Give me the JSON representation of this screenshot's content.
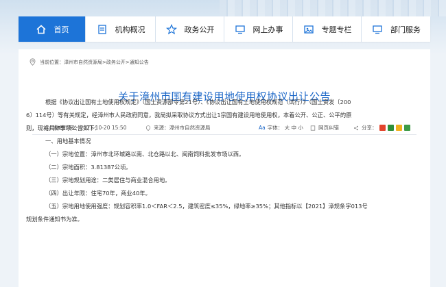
{
  "nav": {
    "items": [
      {
        "label": "首页",
        "icon": "home-icon",
        "active": true
      },
      {
        "label": "机构概况",
        "icon": "document-icon"
      },
      {
        "label": "政务公开",
        "icon": "star-icon"
      },
      {
        "label": "网上办事",
        "icon": "monitor-icon"
      },
      {
        "label": "专题专栏",
        "icon": "image-icon"
      },
      {
        "label": "部门服务",
        "icon": "monitor-icon"
      }
    ]
  },
  "breadcrumb": "当前位置：漳州市自然资源局>政务公开>通知公告",
  "article": {
    "title": "关于漳州市国有建设用地使用权协议出让公告",
    "publish_time": "发布时间： 2021-10-20 15:50",
    "source": "来源：漳州市自然资源局",
    "font_size": "字体：  大  中  小",
    "error_report": "网页纠错",
    "share": "分享：",
    "paragraphs": [
      "根据《协议出让国有土地使用权规定》（国土资源部令第21号）、《协议出让国有土地使用权规范（试行）》（国土资发〔200",
      "6〕114号）等有关规定，经漳州市人民政府同意，我局拟采取协议方式出让1宗国有建设用地使用权，本着公开、公正、公平的原",
      "则，现将具体事项公告如下：",
      "一、用地基本情况",
      "（一）宗地位置：漳州市北环城路以南、北仓路以北、闽南饲料批发市场以西。",
      "（二）宗地面积：3.81387公顷。",
      "（三）宗地规划用途：二类居住与商业混合用地。",
      "（四）出让年限：住宅70年，商业40年。",
      "（五）宗地用地使用强度：规划容积率1.0＜FAR＜2.5，建筑密度≤35%，绿地率≥35%；其他指标以【2021】漳规条字013号",
      "规划条件通知书为准。"
    ]
  },
  "colors": {
    "primary": "#1d74d8",
    "title": "#1a66c7"
  }
}
